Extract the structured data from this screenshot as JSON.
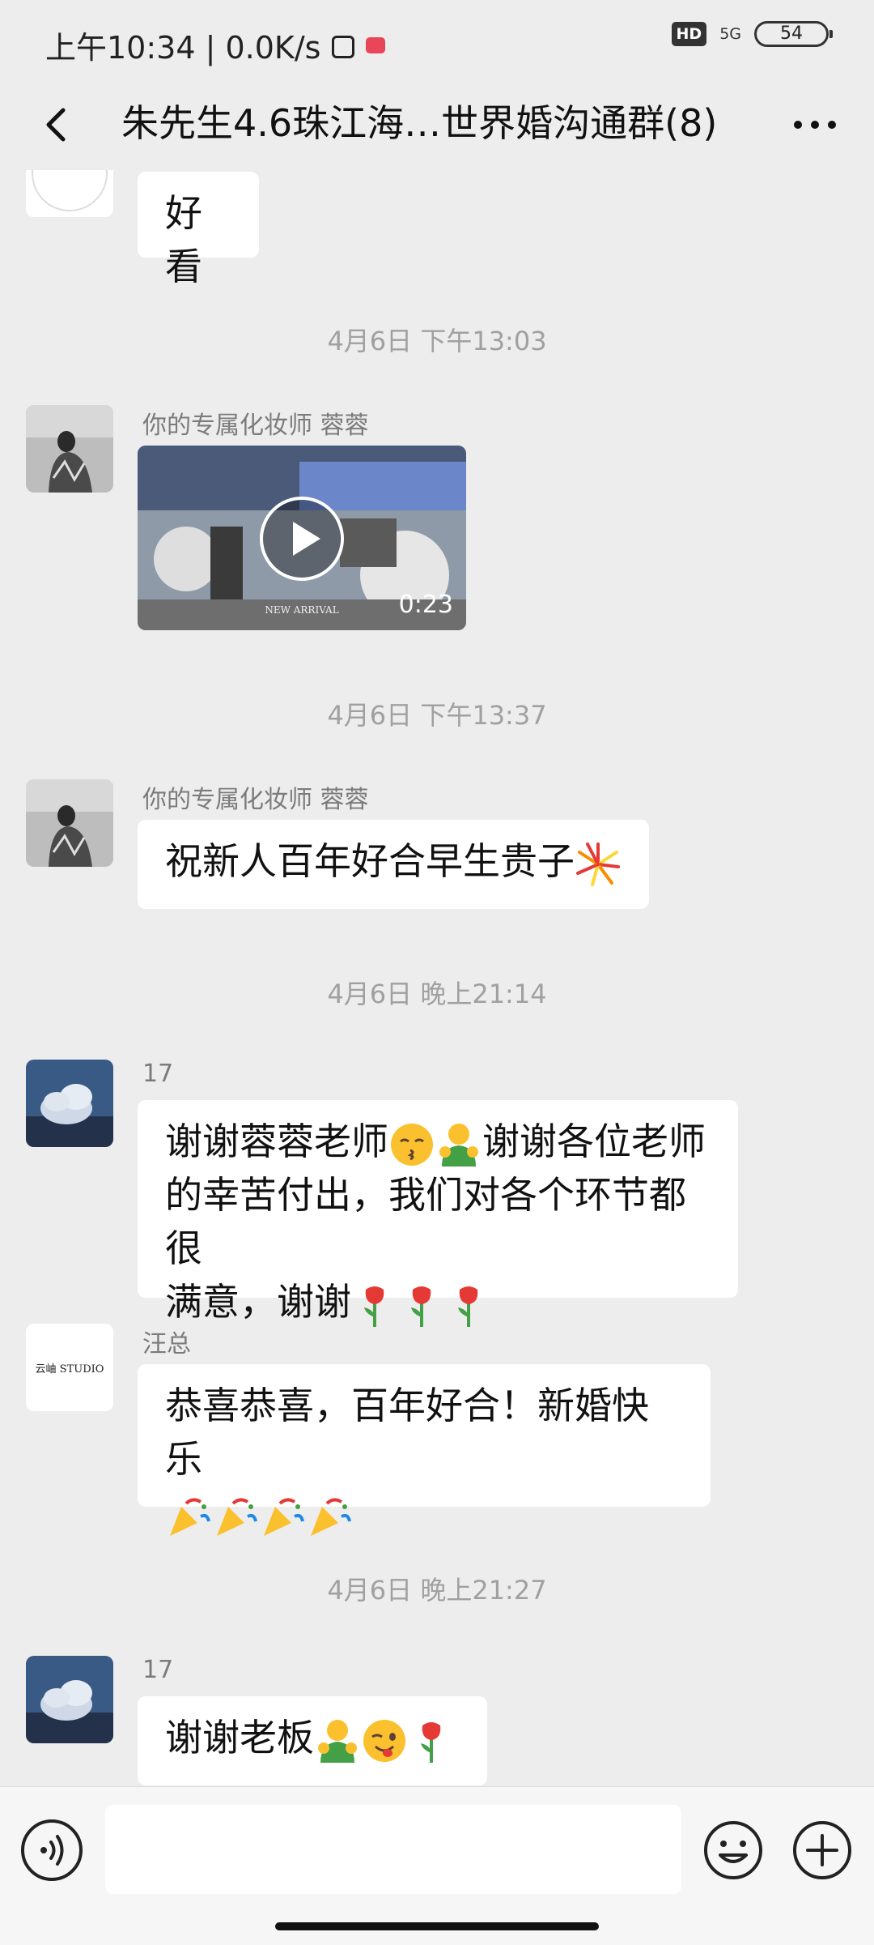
{
  "status_bar": {
    "time_speed": "上午10:34 | 0.0K/s",
    "hd": "HD",
    "network": "5G",
    "battery": "54"
  },
  "header": {
    "title": "朱先生4.6珠江海…世界婚沟通群(8)"
  },
  "chat": {
    "m1_text": "好看",
    "ts1": "4月6日 下午13:03",
    "m2_sender": "你的专属化妆师  蓉蓉",
    "m2_video_duration": "0:23",
    "m2_video_caption": "NEW ARRIVAL",
    "ts2": "4月6日 下午13:37",
    "m3_sender": "你的专属化妆师  蓉蓉",
    "m3_text": "祝新人百年好合早生贵子",
    "ts3": "4月6日 晚上21:14",
    "m4_sender": "17",
    "m4_l1a": "谢谢蓉蓉老师",
    "m4_l1b": "谢谢各位老师",
    "m4_l2": "的幸苦付出，我们对各个环节都很",
    "m4_l3": "满意，谢谢",
    "m5_sender": "汪总",
    "m5_avatar_text": "云岫 STUDIO",
    "m5_text": "恭喜恭喜，百年好合！新婚快乐",
    "ts4": "4月6日 晚上21:27",
    "m6_sender": "17",
    "m6_text": "谢谢老板"
  },
  "colors": {
    "background": "#ededed",
    "bubble": "#ffffff",
    "timestamp": "#a0a0a0",
    "sender": "#7b7b7b"
  }
}
